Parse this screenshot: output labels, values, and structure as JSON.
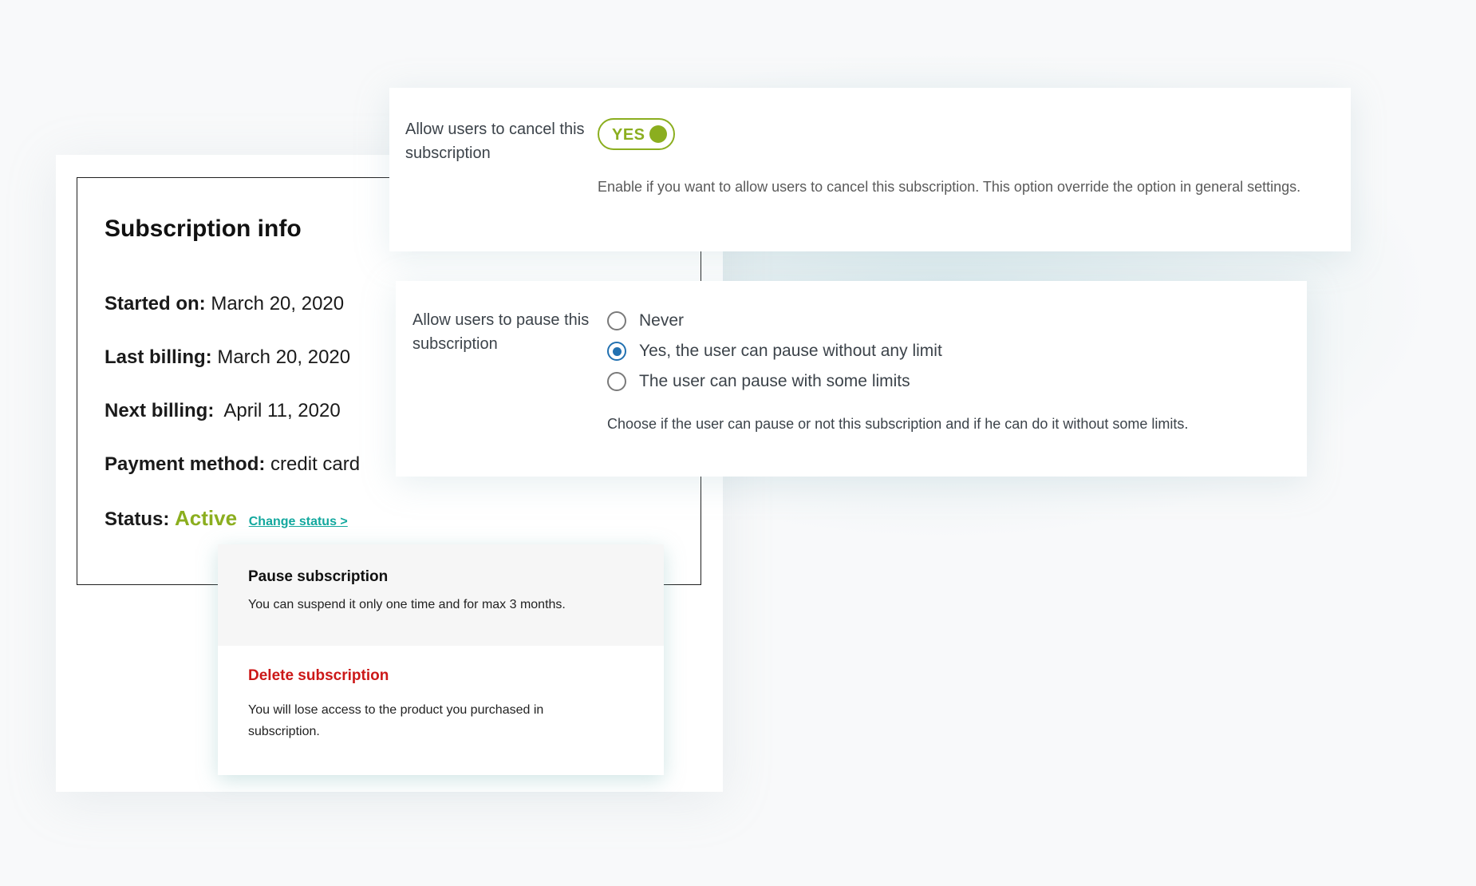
{
  "subscription_info": {
    "title": "Subscription info",
    "rows": [
      {
        "label": "Started on:",
        "value": "March 20, 2020"
      },
      {
        "label": "Last billing:",
        "value": "March 20, 2020"
      },
      {
        "label": "Next billing:",
        "value": " April 11, 2020"
      },
      {
        "label": "Payment method:",
        "value": "credit card"
      }
    ],
    "status_label": "Status:",
    "status_value": "Active",
    "change_status_link": "Change status >"
  },
  "status_menu": {
    "pause": {
      "title": "Pause subscription",
      "text": "You can suspend it only one time and for max 3 months."
    },
    "delete": {
      "title": "Delete subscription",
      "text": "You will lose access to the product you purchased in subscription."
    }
  },
  "cancel_setting": {
    "label": "Allow users to cancel this subscription",
    "toggle_label": "YES",
    "toggle_on": true,
    "description": "Enable if you want to allow users to cancel this subscription. This option override the option in general settings."
  },
  "pause_setting": {
    "label": "Allow users to pause this subscription",
    "options": [
      {
        "label": "Never",
        "checked": false
      },
      {
        "label": "Yes, the user can pause without any limit",
        "checked": true
      },
      {
        "label": "The user can pause with some limits",
        "checked": false
      }
    ],
    "description": "Choose if the user can pause or not this subscription and if he can do it without some limits."
  },
  "colors": {
    "active_green": "#8bae1f",
    "link_teal": "#13a89e",
    "delete_red": "#cc1818",
    "radio_blue": "#2271b1"
  }
}
